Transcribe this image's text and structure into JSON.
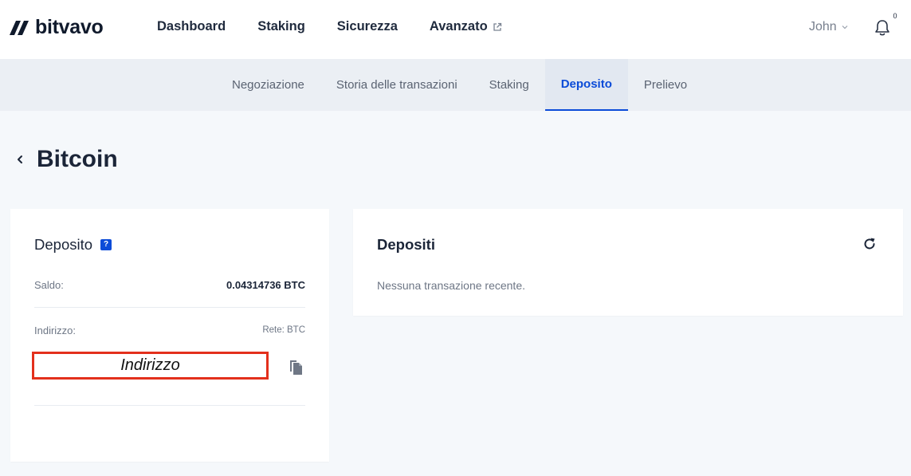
{
  "brand": {
    "name": "bitvavo"
  },
  "main_nav": [
    {
      "label": "Dashboard"
    },
    {
      "label": "Staking"
    },
    {
      "label": "Sicurezza"
    },
    {
      "label": "Avanzato"
    }
  ],
  "user": {
    "name": "John"
  },
  "notifications": {
    "count": "0"
  },
  "sub_nav": [
    {
      "label": "Negoziazione",
      "active": false
    },
    {
      "label": "Storia delle transazioni",
      "active": false
    },
    {
      "label": "Staking",
      "active": false
    },
    {
      "label": "Deposito",
      "active": true
    },
    {
      "label": "Prelievo",
      "active": false
    }
  ],
  "page": {
    "title": "Bitcoin"
  },
  "deposit_card": {
    "title": "Deposito",
    "help": "?",
    "balance_label": "Saldo:",
    "balance_value": "0.04314736 BTC",
    "address_label": "Indirizzo:",
    "network": "Rete: BTC",
    "address_value": "Indirizzo"
  },
  "deposits_card": {
    "title": "Depositi",
    "empty_message": "Nessuna transazione recente."
  },
  "colors": {
    "accent": "#0b4bd8",
    "highlight_border": "#e3301c",
    "page_bg": "#f5f8fb",
    "subnav_bg": "#ebeff4"
  },
  "icons": [
    "back-chevron-icon",
    "help-icon",
    "copy-icon",
    "refresh-icon",
    "bell-icon",
    "external-link-icon",
    "chevron-down-icon"
  ]
}
